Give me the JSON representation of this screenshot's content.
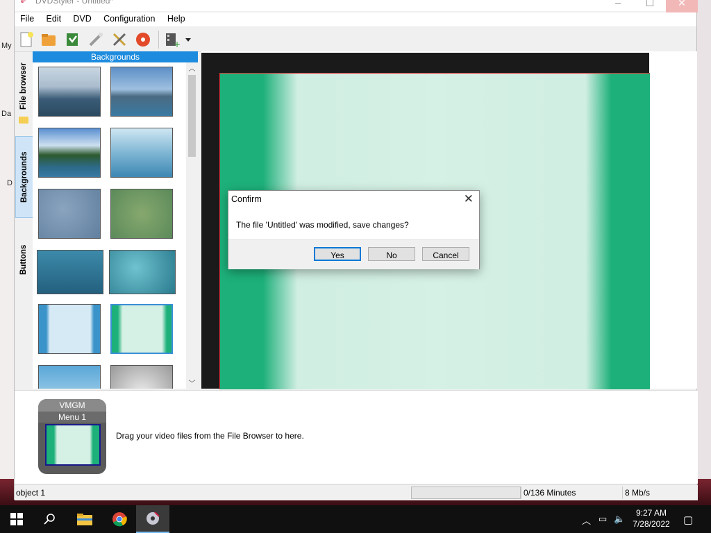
{
  "window": {
    "title": "DVDStyler - Untitled*",
    "menus": [
      "File",
      "Edit",
      "DVD",
      "Configuration",
      "Help"
    ],
    "toolbar_icons": [
      "new-icon",
      "open-icon",
      "save-icon",
      "burn-wand-icon",
      "settings-icon",
      "dvd-burn-icon",
      "add-video-icon",
      "dropdown-icon"
    ]
  },
  "desktop": {
    "labels": [
      "My",
      "Da",
      "D"
    ]
  },
  "left_panel": {
    "tabs": [
      "File browser",
      "Backgrounds",
      "Buttons"
    ],
    "header": "Backgrounds"
  },
  "titleset": {
    "vmgm_label": "VMGM",
    "menu_label": "Menu 1",
    "drag_hint": "Drag your video files from the File Browser to here."
  },
  "status": {
    "object": "object 1",
    "minutes": "0/136 Minutes",
    "bitrate": "8 Mb/s"
  },
  "dialog": {
    "title": "Confirm",
    "message": "The file 'Untitled' was modified, save changes?",
    "yes": "Yes",
    "no": "No",
    "cancel": "Cancel"
  },
  "taskbar": {
    "time": "9:27 AM",
    "date": "7/28/2022"
  },
  "colors": {
    "accent": "#1e8cde",
    "menu_green": "#1db07a",
    "menu_light": "#d5f0e4"
  }
}
